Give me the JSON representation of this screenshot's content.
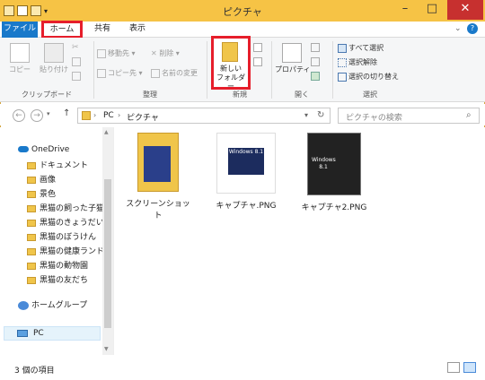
{
  "window": {
    "title": "ピクチャ"
  },
  "ribbon_tabs": {
    "file": "ファイル",
    "home": "ホーム",
    "share": "共有",
    "view": "表示"
  },
  "ribbon": {
    "clipboard": {
      "copy": "コピー",
      "paste": "貼り付け",
      "label": "クリップボード"
    },
    "organize": {
      "move_to": "移動先",
      "copy_to": "コピー先",
      "delete": "削除",
      "rename": "名前の変更",
      "label": "整理"
    },
    "new": {
      "new_folder_line1": "新しい",
      "new_folder_line2": "フォルダー",
      "label": "新規"
    },
    "open": {
      "properties": "プロパティ",
      "label": "開く"
    },
    "select": {
      "select_all": "すべて選択",
      "select_none": "選択解除",
      "invert": "選択の切り替え",
      "label": "選択"
    }
  },
  "address": {
    "root": "PC",
    "current": "ピクチャ"
  },
  "search": {
    "placeholder": "ピクチャの検索"
  },
  "nav": {
    "onedrive": "OneDrive",
    "items": [
      "ドキュメント",
      "画像",
      "景色",
      "黒猫の飼った子猫",
      "黒猫のきょうだい",
      "黒猫のぼうけん",
      "黒猫の健康ランド",
      "黒猫の動物園",
      "黒猫の友だち"
    ],
    "homegroup": "ホームグループ",
    "pc": "PC"
  },
  "files": [
    {
      "name": "スクリーンショット",
      "type": "folder"
    },
    {
      "name": "キャプチャ.PNG",
      "type": "image",
      "thumb_text": "Windows 8.1"
    },
    {
      "name": "キャプチャ2.PNG",
      "type": "image",
      "thumb_text": "Windows 8.1"
    }
  ],
  "status": {
    "count": "3 個の項目"
  },
  "colors": {
    "titlebar": "#f6c345",
    "file_tab": "#1979ca",
    "highlight": "#e61e2b"
  }
}
